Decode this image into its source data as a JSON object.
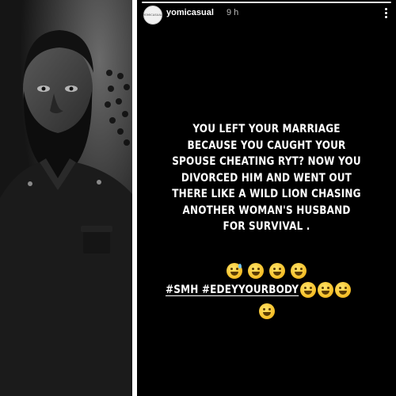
{
  "story": {
    "username": "yomicasual",
    "time_ago": "9 h",
    "avatar_text": "YOMICASUAL",
    "message_lines": [
      "YOU LEFT YOUR MARRIAGE",
      "BECAUSE YOU CAUGHT YOUR",
      "SPOUSE CHEATING RYT? NOW YOU",
      "DIVORCED HIM AND WENT OUT",
      "THERE LIKE A WILD LION CHASING",
      "ANOTHER WOMAN'S HUSBAND",
      "FOR SURVIVAL ."
    ],
    "hashtags": "#SMH #EDEYYOURBODY",
    "emoji_icons": [
      "sweat-smile-emoji",
      "grin-emoji",
      "grin-emoji",
      "grin-emoji"
    ],
    "trailing_emoji_icons": [
      "grin-emoji",
      "grin-emoji",
      "grin-emoji",
      "grin-emoji"
    ],
    "more_icon": "more-vertical-icon"
  },
  "photo": {
    "description_icon": "portrait-photo",
    "background_color": "#1a1a1a"
  }
}
